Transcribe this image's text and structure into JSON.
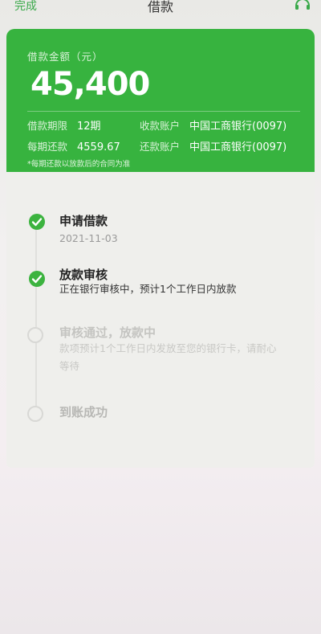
{
  "header": {
    "done_label": "完成",
    "title": "借款"
  },
  "loan": {
    "amount_label": "借款金额（元）",
    "amount": "45,400",
    "term_label": "借款期限",
    "term_value": "12期",
    "receive_label": "收款账户",
    "receive_value": "中国工商银行(0097)",
    "repay_label": "每期还款",
    "repay_value": "4559.67",
    "repay_account_label": "还款账户",
    "repay_account_value": "中国工商银行(0097)",
    "note": "*每期还款以放款后的合同为准"
  },
  "steps": [
    {
      "title": "申请借款",
      "subtitle": "2021-11-03",
      "status": "done"
    },
    {
      "title": "放款审核",
      "subtitle": "正在银行审核中，预计1个工作日内放款",
      "status": "done"
    },
    {
      "title": "审核通过，放款中",
      "subtitle_line1": "款项预计1个工作日内发放至您的银行卡，请耐心",
      "subtitle_line2": "等待",
      "status": "pending"
    },
    {
      "title": "到账成功",
      "status": "pending"
    }
  ],
  "colors": {
    "accent": "#37b33f",
    "pending": "#cfcfcc"
  }
}
